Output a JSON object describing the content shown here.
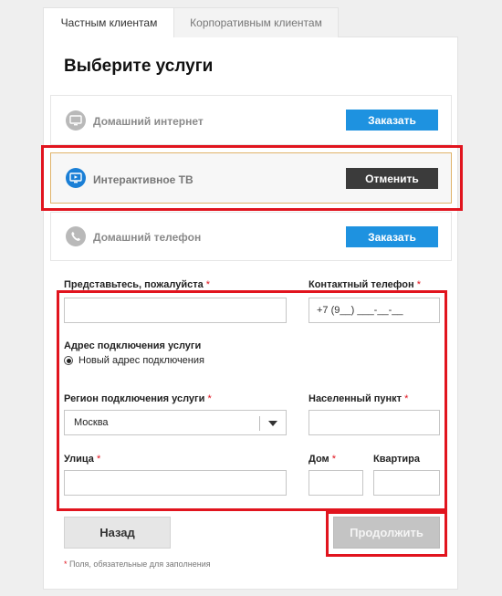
{
  "tabs": {
    "private": "Частным клиентам",
    "corporate": "Корпоративным клиентам"
  },
  "page_title": "Выберите услуги",
  "services": [
    {
      "label": "Домашний интернет",
      "button": "Заказать",
      "icon": "tv-monitor-icon",
      "selected": false
    },
    {
      "label": "Интерактивное ТВ",
      "button": "Отменить",
      "icon": "interactive-tv-icon",
      "selected": true
    },
    {
      "label": "Домашний телефон",
      "button": "Заказать",
      "icon": "phone-icon",
      "selected": false
    }
  ],
  "form": {
    "name_label": "Представьтесь, пожалуйста",
    "name_value": "",
    "phone_label": "Контактный телефон",
    "phone_value": "+7 (9__) ___-__-__",
    "address_heading": "Адрес подключения услуги",
    "address_option": "Новый адрес подключения",
    "region_label": "Регион подключения услуги",
    "region_value": "Москва",
    "city_label": "Населенный пункт",
    "city_value": "",
    "street_label": "Улица",
    "street_value": "",
    "house_label": "Дом",
    "house_value": "",
    "apartment_label": "Квартира",
    "apartment_value": "",
    "required_mark": "*"
  },
  "buttons": {
    "back": "Назад",
    "continue": "Продолжить"
  },
  "note": {
    "mark": "*",
    "text": " Поля, обязательные для заполнения"
  },
  "colors": {
    "accent_blue": "#1e92e0",
    "dark_button": "#3b3b3b",
    "highlight_red": "#e1141e",
    "selected_border": "#e0b36a"
  }
}
